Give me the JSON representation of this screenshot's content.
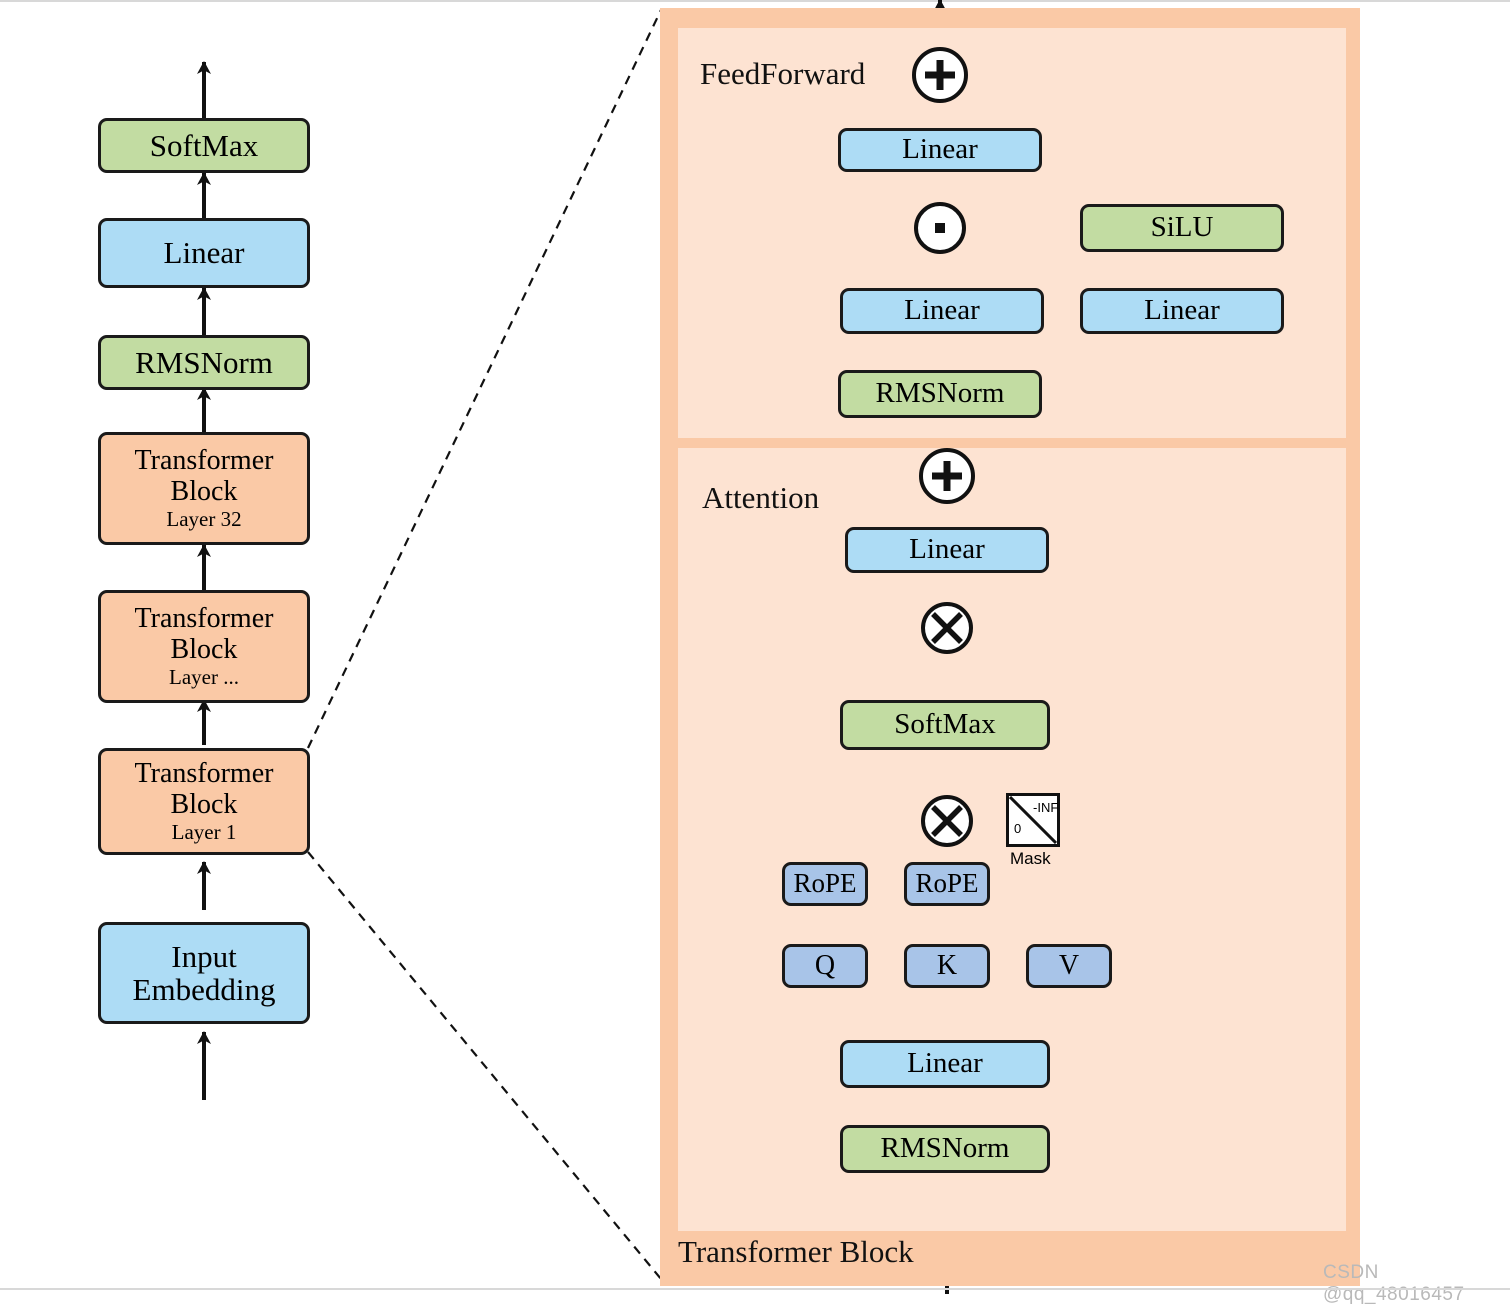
{
  "left_column": {
    "nodes": [
      {
        "label": "SoftMax",
        "sub": "",
        "color": "green"
      },
      {
        "label": "Linear",
        "sub": "",
        "color": "blue"
      },
      {
        "label": "RMSNorm",
        "sub": "",
        "color": "green"
      },
      {
        "label": "Transformer Block",
        "sub": "Layer 32",
        "color": "orange"
      },
      {
        "label": "Transformer Block",
        "sub": "Layer ...",
        "color": "orange"
      },
      {
        "label": "Transformer Block",
        "sub": "Layer 1",
        "color": "orange"
      },
      {
        "label": "Input Embedding",
        "sub": "",
        "color": "blue"
      }
    ]
  },
  "detail": {
    "outer_label": "Transformer Block",
    "feedforward": {
      "label": "FeedForward",
      "add_symbol": "+",
      "mul_symbol": "·",
      "nodes": {
        "out_linear": "Linear",
        "silu": "SiLU",
        "gate_linear": "Linear",
        "up_linear": "Linear",
        "rmsnorm": "RMSNorm"
      }
    },
    "attention": {
      "label": "Attention",
      "add_symbol": "+",
      "matmul_symbol": "×",
      "nodes": {
        "out_linear": "Linear",
        "softmax": "SoftMax",
        "rope_q": "RoPE",
        "rope_k": "RoPE",
        "q": "Q",
        "k": "K",
        "v": "V",
        "qkv_linear": "Linear",
        "rmsnorm": "RMSNorm"
      },
      "mask": {
        "caption": "Mask",
        "upper_right": "-INF",
        "lower_left": "0"
      }
    }
  },
  "colors": {
    "blue": "#addcf5",
    "blue_dark": "#a8c4e8",
    "green": "#c2dca2",
    "orange": "#fac9a6",
    "panel_outer": "#fac9a6",
    "panel_inner": "#fde3d2",
    "stroke": "#1a1a1a"
  },
  "watermark": "CSDN @qq_48016457"
}
